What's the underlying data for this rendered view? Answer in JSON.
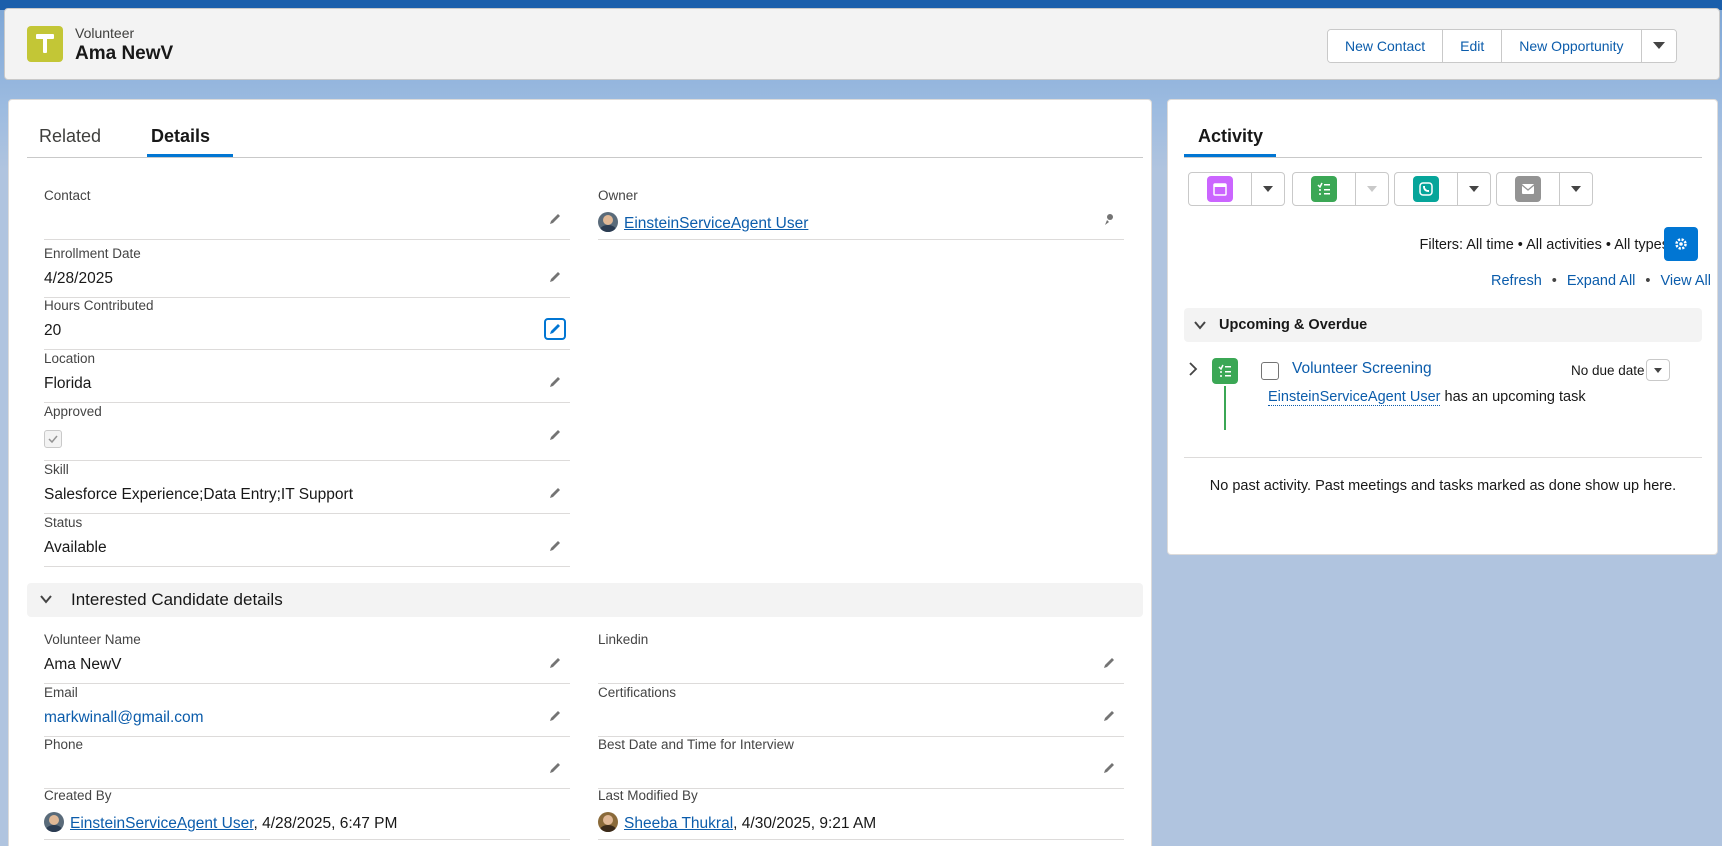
{
  "header": {
    "record_type": "Volunteer",
    "record_name": "Ama NewV",
    "actions": [
      "New Contact",
      "Edit",
      "New Opportunity"
    ],
    "colors": {
      "record_icon": "#c3c636",
      "brand": "#0176d3"
    },
    "icon": "tool-icon"
  },
  "tabs": {
    "related": "Related",
    "details": "Details",
    "active": "Details"
  },
  "details": {
    "contact": {
      "label": "Contact",
      "value": ""
    },
    "owner": {
      "label": "Owner",
      "value": "EinsteinServiceAgent User"
    },
    "enrollment_date": {
      "label": "Enrollment Date",
      "value": "4/28/2025"
    },
    "hours": {
      "label": "Hours Contributed",
      "value": "20"
    },
    "location": {
      "label": "Location",
      "value": "Florida"
    },
    "approved": {
      "label": "Approved",
      "checked": true
    },
    "skill": {
      "label": "Skill",
      "value": "Salesforce Experience;Data Entry;IT Support"
    },
    "status": {
      "label": "Status",
      "value": "Available"
    }
  },
  "section": {
    "title": "Interested Candidate details",
    "volunteer_name": {
      "label": "Volunteer Name",
      "value": "Ama NewV"
    },
    "linkedin": {
      "label": "Linkedin",
      "value": ""
    },
    "email": {
      "label": "Email",
      "value": "markwinall@gmail.com"
    },
    "certifications": {
      "label": "Certifications",
      "value": ""
    },
    "phone": {
      "label": "Phone",
      "value": ""
    },
    "best_time": {
      "label": "Best Date and Time for Interview",
      "value": ""
    },
    "created_by": {
      "label": "Created By",
      "user": "EinsteinServiceAgent User",
      "date": ", 4/28/2025, 6:47 PM"
    },
    "last_modified": {
      "label": "Last Modified By",
      "user": "Sheeba Thukral",
      "date": ", 4/30/2025, 9:21 AM"
    }
  },
  "activity": {
    "tab": "Activity",
    "filters": "Filters: All time • All activities • All types",
    "links": [
      "Refresh",
      "Expand All",
      "View All"
    ],
    "upcoming_title": "Upcoming & Overdue",
    "task": {
      "title": "Volunteer Screening",
      "due": "No due date",
      "user": "EinsteinServiceAgent User",
      "suffix": " has an upcoming task"
    },
    "no_past": "No past activity. Past meetings and tasks marked as done show up here.",
    "publisher_colors": {
      "event": "#cb65ff",
      "task": "#3ba755",
      "call": "#06a59a",
      "email": "#939393"
    }
  }
}
